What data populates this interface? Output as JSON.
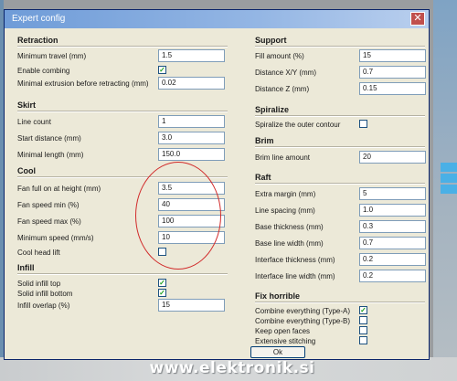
{
  "window": {
    "title": "Expert config",
    "close_label": "✕"
  },
  "left": {
    "sections": [
      {
        "title": "Retraction",
        "rows": [
          {
            "label": "Minimum travel (mm)",
            "type": "input",
            "value": "1.5"
          },
          {
            "label": "Enable combing",
            "type": "checkbox",
            "checked": true
          },
          {
            "label": "Minimal extrusion before retracting (mm)",
            "type": "input",
            "value": "0.02"
          }
        ]
      },
      {
        "title": "Skirt",
        "rows": [
          {
            "label": "Line count",
            "type": "input",
            "value": "1"
          },
          {
            "label": "Start distance (mm)",
            "type": "input",
            "value": "3.0"
          },
          {
            "label": "Minimal length (mm)",
            "type": "input",
            "value": "150.0"
          }
        ]
      },
      {
        "title": "Cool",
        "rows": [
          {
            "label": "Fan full on at height (mm)",
            "type": "input",
            "value": "3.5"
          },
          {
            "label": "Fan speed min (%)",
            "type": "input",
            "value": "40"
          },
          {
            "label": "Fan speed max (%)",
            "type": "input",
            "value": "100"
          },
          {
            "label": "Minimum speed (mm/s)",
            "type": "input",
            "value": "10"
          },
          {
            "label": "Cool head lift",
            "type": "checkbox",
            "checked": false
          }
        ]
      },
      {
        "title": "Infill",
        "rows": [
          {
            "label": "Solid infill top",
            "type": "checkbox",
            "checked": true
          },
          {
            "label": "Solid infill bottom",
            "type": "checkbox",
            "checked": true
          },
          {
            "label": "Infill overlap (%)",
            "type": "input",
            "value": "15"
          }
        ]
      }
    ]
  },
  "right": {
    "sections": [
      {
        "title": "Support",
        "rows": [
          {
            "label": "Fill amount (%)",
            "type": "input",
            "value": "15"
          },
          {
            "label": "Distance X/Y (mm)",
            "type": "input",
            "value": "0.7"
          },
          {
            "label": "Distance Z (mm)",
            "type": "input",
            "value": "0.15"
          }
        ]
      },
      {
        "title": "Spiralize",
        "rows": [
          {
            "label": "Spiralize the outer contour",
            "type": "checkbox",
            "checked": false
          }
        ]
      },
      {
        "title": "Brim",
        "rows": [
          {
            "label": "Brim line amount",
            "type": "input",
            "value": "20"
          }
        ]
      },
      {
        "title": "Raft",
        "rows": [
          {
            "label": "Extra margin (mm)",
            "type": "input",
            "value": "5"
          },
          {
            "label": "Line spacing (mm)",
            "type": "input",
            "value": "1.0"
          },
          {
            "label": "Base thickness (mm)",
            "type": "input",
            "value": "0.3"
          },
          {
            "label": "Base line width (mm)",
            "type": "input",
            "value": "0.7"
          },
          {
            "label": "Interface thickness (mm)",
            "type": "input",
            "value": "0.2"
          },
          {
            "label": "Interface line width (mm)",
            "type": "input",
            "value": "0.2"
          }
        ]
      },
      {
        "title": "Fix horrible",
        "rows": [
          {
            "label": "Combine everything (Type-A)",
            "type": "checkbox",
            "checked": true
          },
          {
            "label": "Combine everything (Type-B)",
            "type": "checkbox",
            "checked": false
          },
          {
            "label": "Keep open faces",
            "type": "checkbox",
            "checked": false
          },
          {
            "label": "Extensive stitching",
            "type": "checkbox",
            "checked": false
          }
        ]
      }
    ]
  },
  "footer": {
    "ok_label": "Ok"
  },
  "watermark": "www.elektronik.si",
  "colors": {
    "title_gradient_start": "#6f9cd8",
    "check_mark": "#21a121",
    "annotation_circle": "#d12a2a"
  }
}
